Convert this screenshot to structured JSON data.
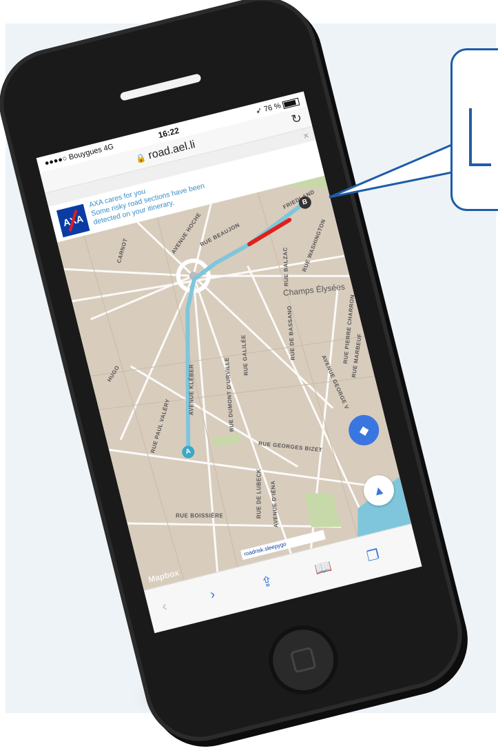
{
  "status_bar": {
    "carrier": "●●●●○ Bouygues  4G",
    "time": "16:22",
    "battery": "76 %"
  },
  "browser": {
    "url": "road.ael.li",
    "close_glyph": "×"
  },
  "banner": {
    "logo": "AXA",
    "line1": "AXA cares for you",
    "line2": "Some risky road sections have been",
    "line3": "detected on your itinerary."
  },
  "map": {
    "streets": [
      "AVENUE HOCHE",
      "RUE BEAUJON",
      "RUE BALZAC",
      "RUE WASHINGTON",
      "RUE DE BASSANO",
      "RUE GALILÉE",
      "AVENUE KLÉBER",
      "RUE DUMONT D'URVILLE",
      "AVENUE GEORGE V",
      "RUE PIERRE CHARRON",
      "RUE MARBEUF",
      "RUE GEORGES BIZET",
      "RUE DE LUBECK",
      "AVENUE D'IÉNA",
      "RUE BOISSIÈRE",
      "RUE PAUL VALÉRY",
      "CARNOT",
      "HUGO",
      "FRIEDLAND"
    ],
    "district": "Champs Élysées",
    "pin_a": "A",
    "pin_b": "B",
    "brand": "Mapbox",
    "attribution": "roadrisk.sleepygo",
    "route_color": "#7fc6dc",
    "risk_color": "#e0201c"
  },
  "toolbar": {
    "back": "‹",
    "forward": "›"
  }
}
